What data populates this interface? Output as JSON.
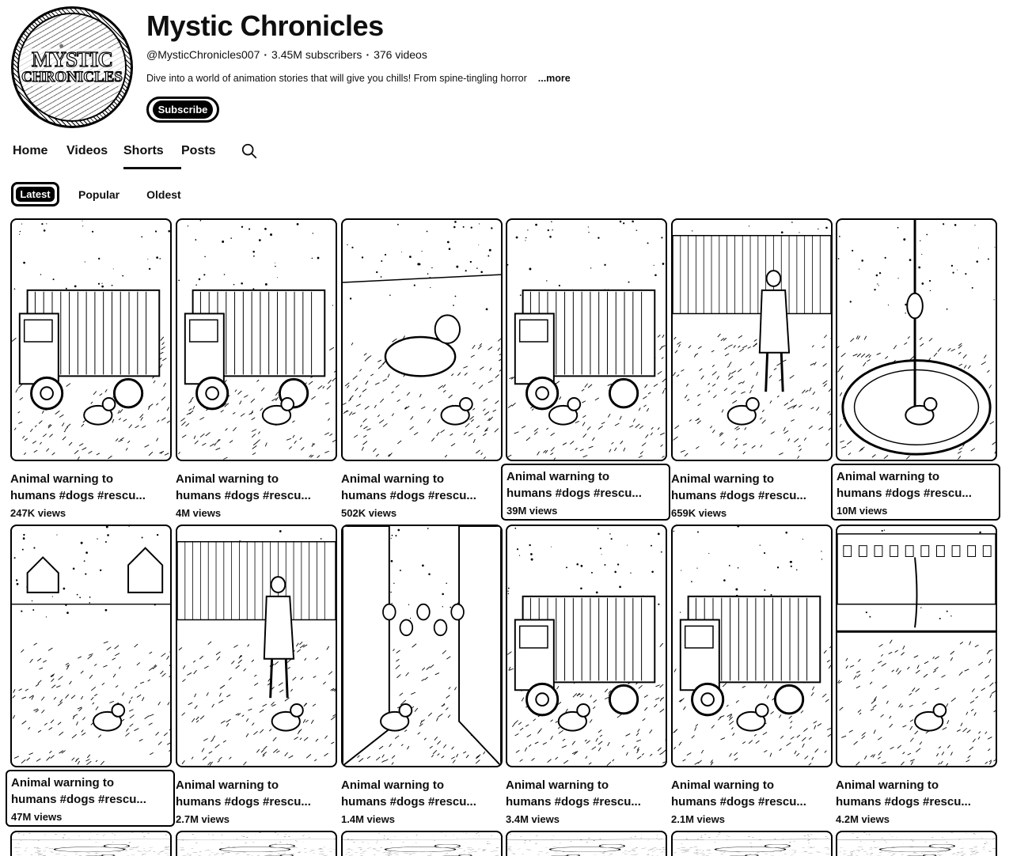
{
  "channel": {
    "avatar_text_line1": "MYSTIC",
    "avatar_text_line2": "CHRONICLES",
    "name": "Mystic Chronicles",
    "handle": "@MysticChronicles007",
    "subscribers": "3.45M subscribers",
    "videos": "376 videos",
    "separator": "·",
    "description": "Dive into a world of animation stories that will give you chills! From spine-tingling horror",
    "more_label": "...more",
    "subscribe_label": "Subscribe"
  },
  "tabs": [
    {
      "label": "Home",
      "active": false
    },
    {
      "label": "Videos",
      "active": false
    },
    {
      "label": "Shorts",
      "active": true
    },
    {
      "label": "Posts",
      "active": false
    }
  ],
  "search_icon": "search-icon",
  "chips": [
    {
      "label": "Latest",
      "active": true
    },
    {
      "label": "Popular",
      "active": false
    },
    {
      "label": "Oldest",
      "active": false
    }
  ],
  "shorts": [
    {
      "title_line1": "Animal warning to",
      "title_line2": "humans #dogs #rescu...",
      "views": "247K views",
      "scene": "truck-side"
    },
    {
      "title_line1": "Animal warning to",
      "title_line2": "humans #dogs #rescu...",
      "views": "4M views",
      "scene": "truck-road"
    },
    {
      "title_line1": "Animal warning to",
      "title_line2": "humans #dogs #rescu...",
      "views": "502K views",
      "scene": "field-dog"
    },
    {
      "title_line1": "Animal warning to",
      "title_line2": "humans #dogs #rescu...",
      "views": "39M views",
      "scene": "truck-field"
    },
    {
      "title_line1": "Animal warning to",
      "title_line2": "humans #dogs #rescu...",
      "views": "659K views",
      "scene": "barn-man"
    },
    {
      "title_line1": "Animal warning to",
      "title_line2": "humans #dogs #rescu...",
      "views": "10M views",
      "scene": "well"
    },
    {
      "title_line1": "Animal warning to",
      "title_line2": "humans #dogs #rescu...",
      "views": "47M views",
      "scene": "meadow-houses"
    },
    {
      "title_line1": "Animal warning to",
      "title_line2": "humans #dogs #rescu...",
      "views": "2.7M views",
      "scene": "man-fence"
    },
    {
      "title_line1": "Animal warning to",
      "title_line2": "humans #dogs #rescu...",
      "views": "1.4M views",
      "scene": "street-crowd"
    },
    {
      "title_line1": "Animal warning to",
      "title_line2": "humans #dogs #rescu...",
      "views": "3.4M views",
      "scene": "truck-back"
    },
    {
      "title_line1": "Animal warning to",
      "title_line2": "humans #dogs #rescu...",
      "views": "2.1M views",
      "scene": "truck-front"
    },
    {
      "title_line1": "Animal warning to",
      "title_line2": "humans #dogs #rescu...",
      "views": "4.2M views",
      "scene": "fountain"
    }
  ]
}
